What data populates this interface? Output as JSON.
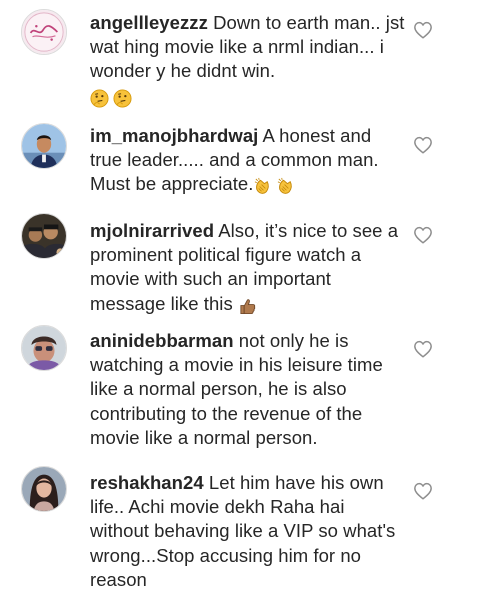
{
  "comments": [
    {
      "username": "angellleyezzz",
      "text": "Down to earth man.. jst wat hing movie like a nrml indian... i wonder y he didnt win.",
      "emojis": [
        "thinking-face",
        "thinking-face"
      ]
    },
    {
      "username": "im_manojbhardwaj",
      "text": "A honest and true leader..... and a common man. Must be appreciate.",
      "emojis": [
        "clapping-hands",
        "clapping-hands"
      ]
    },
    {
      "username": "mjolnirarrived",
      "text": "Also, it’s nice to see a prominent political figure watch a movie with such an important message like this",
      "emojis": [
        "thumbs-up"
      ]
    },
    {
      "username": "aninidebbarman",
      "text": "not only he is watching a movie in his leisure time like a normal person, he is also contributing to the revenue of the movie like a normal person.",
      "emojis": []
    },
    {
      "username": "reshakhan24",
      "text": "Let him have his own life.. Achi movie dekh Raha hai without behaving like a VIP so what's wrong...Stop accusing him for no reason",
      "emojis": []
    }
  ],
  "like_icon": "heart-outline-icon",
  "colors": {
    "text": "#262626",
    "icon": "#8e8e8e",
    "border": "#dbdbdb"
  }
}
